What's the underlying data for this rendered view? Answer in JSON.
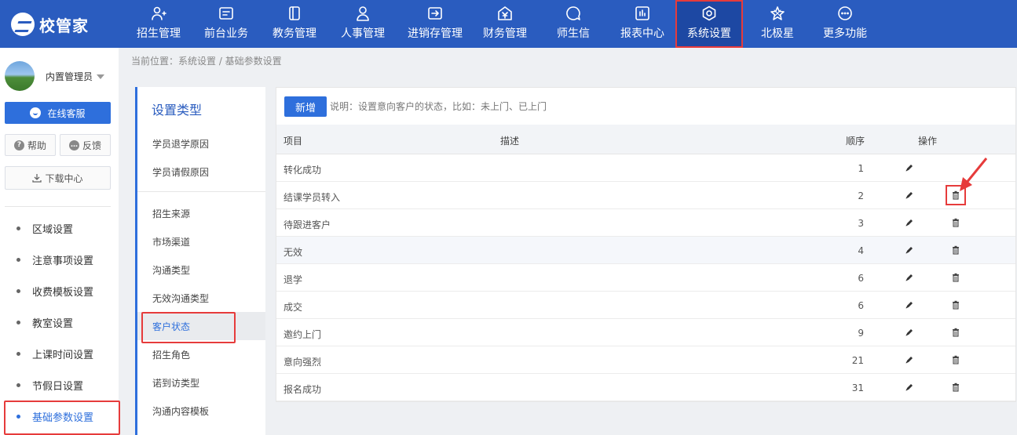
{
  "app": {
    "logo_text": "校管家"
  },
  "nav": {
    "items": [
      {
        "label": "招生管理",
        "icon": "person-add-icon"
      },
      {
        "label": "前台业务",
        "icon": "id-card-icon"
      },
      {
        "label": "教务管理",
        "icon": "book-icon"
      },
      {
        "label": "人事管理",
        "icon": "person-icon"
      },
      {
        "label": "进销存管理",
        "icon": "inbox-arrow-icon"
      },
      {
        "label": "财务管理",
        "icon": "yen-house-icon"
      },
      {
        "label": "师生信",
        "icon": "chat-bubble-icon"
      },
      {
        "label": "报表中心",
        "icon": "bar-chart-icon"
      },
      {
        "label": "系统设置",
        "icon": "gear-hexagon-icon",
        "active": true
      },
      {
        "label": "北极星",
        "icon": "star-icon"
      },
      {
        "label": "更多功能",
        "icon": "more-dots-icon"
      }
    ]
  },
  "sidebar": {
    "user_name": "内置管理员",
    "service_label": "在线客服",
    "help_label": "帮助",
    "feedback_label": "反馈",
    "download_label": "下载中心",
    "menu": [
      {
        "label": "区域设置"
      },
      {
        "label": "注意事项设置"
      },
      {
        "label": "收费模板设置"
      },
      {
        "label": "教室设置"
      },
      {
        "label": "上课时间设置"
      },
      {
        "label": "节假日设置"
      },
      {
        "label": "基础参数设置",
        "active": true
      }
    ]
  },
  "breadcrumb": "当前位置：系统设置 / 基础参数设置",
  "categories": {
    "title": "设置类型",
    "group1": [
      "学员退学原因",
      "学员请假原因"
    ],
    "group2": [
      "招生来源",
      "市场渠道",
      "沟通类型",
      "无效沟通类型",
      "客户状态",
      "招生角色",
      "诺到访类型",
      "沟通内容模板"
    ],
    "active": "客户状态"
  },
  "main": {
    "add_label": "新增",
    "note": "说明：设置意向客户的状态，比如：未上门、已上门",
    "columns": {
      "item": "项目",
      "desc": "描述",
      "order": "顺序",
      "ops": "操作"
    },
    "rows": [
      {
        "item": "转化成功",
        "desc": "",
        "order": "1",
        "deletable": false
      },
      {
        "item": "结课学员转入",
        "desc": "",
        "order": "2",
        "deletable": true
      },
      {
        "item": "待跟进客户",
        "desc": "",
        "order": "3",
        "deletable": true
      },
      {
        "item": "无效",
        "desc": "",
        "order": "4",
        "deletable": true
      },
      {
        "item": "退学",
        "desc": "",
        "order": "6",
        "deletable": true
      },
      {
        "item": "成交",
        "desc": "",
        "order": "6",
        "deletable": true
      },
      {
        "item": "邀约上门",
        "desc": "",
        "order": "9",
        "deletable": true
      },
      {
        "item": "意向强烈",
        "desc": "",
        "order": "21",
        "deletable": true
      },
      {
        "item": "报名成功",
        "desc": "",
        "order": "31",
        "deletable": true
      }
    ]
  },
  "colors": {
    "topbar": "#2a5cbf",
    "accent": "#2e6fdc",
    "highlight_border": "#e63b3b"
  }
}
